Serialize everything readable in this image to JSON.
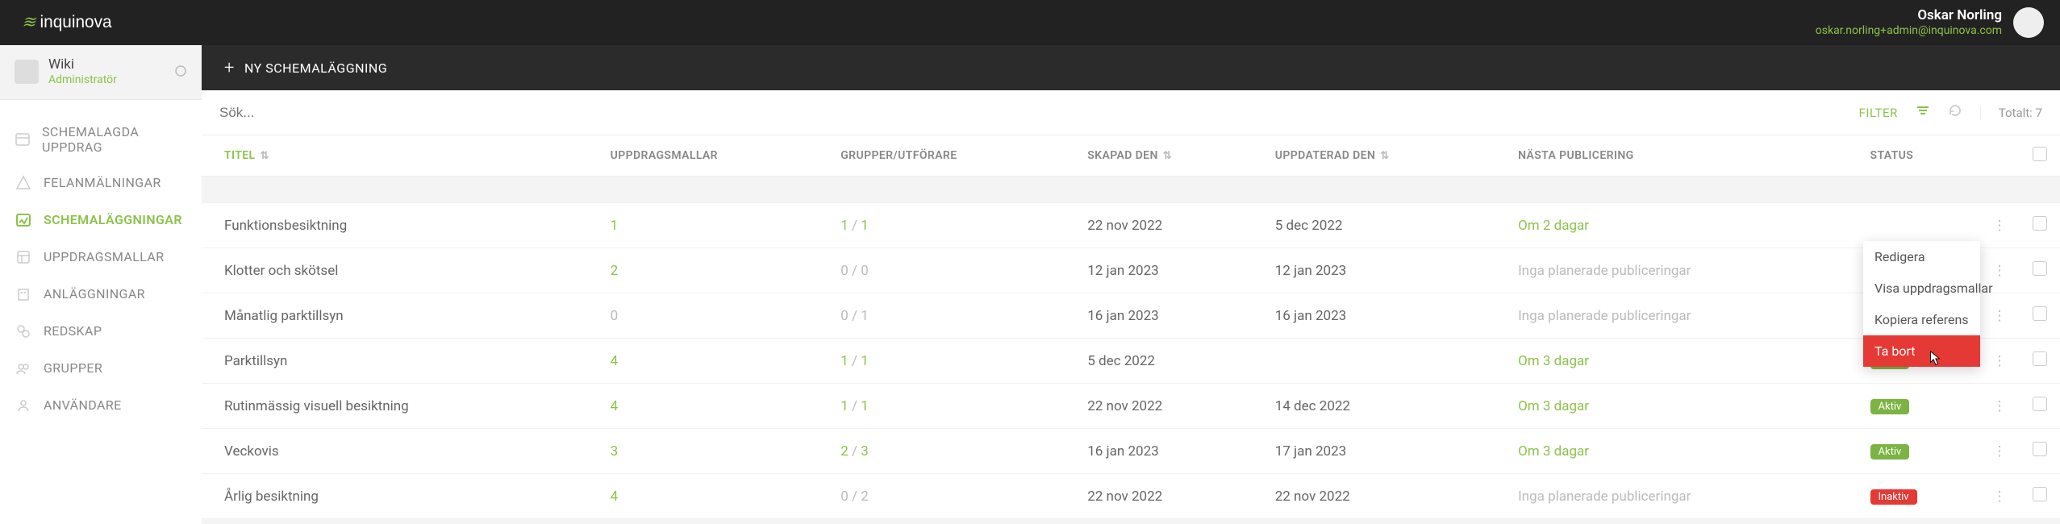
{
  "brand": "inquinova",
  "user": {
    "name": "Oskar Norling",
    "email": "oskar.norling+admin@inquinova.com"
  },
  "side": {
    "profile_name": "Wiki",
    "profile_role": "Administratör",
    "items": [
      {
        "label": "SCHEMALAGDA UPPDRAG"
      },
      {
        "label": "FELANMÄLNINGAR"
      },
      {
        "label": "SCHEMALÄGGNINGAR"
      },
      {
        "label": "UPPDRAGSMALLAR"
      },
      {
        "label": "ANLÄGGNINGAR"
      },
      {
        "label": "REDSKAP"
      },
      {
        "label": "GRUPPER"
      },
      {
        "label": "ANVÄNDARE"
      }
    ]
  },
  "toolbar": {
    "new_label": "NY SCHEMALÄGGNING"
  },
  "filter": {
    "placeholder": "Sök...",
    "filter_label": "FILTER",
    "total_label": "Totalt:",
    "total_value": "7"
  },
  "columns": {
    "title": "TITEL",
    "templates": "UPPDRAGSMALLAR",
    "groups": "GRUPPER/UTFÖRARE",
    "created": "SKAPAD DEN",
    "updated": "UPPDATERAD DEN",
    "next": "NÄSTA PUBLICERING",
    "status": "STATUS"
  },
  "rows": [
    {
      "title": "Funktionsbesiktning",
      "templates": "1",
      "g1": "1",
      "g2": "1",
      "g1zero": false,
      "created": "22 nov 2022",
      "updated": "5 dec 2022",
      "next": "Om 2 dagar",
      "next_plan": false,
      "status": "",
      "badge": ""
    },
    {
      "title": "Klotter och skötsel",
      "templates": "2",
      "g1": "0",
      "g2": "0",
      "g1zero": true,
      "created": "12 jan 2023",
      "updated": "12 jan 2023",
      "next": "Inga planerade publiceringar",
      "next_plan": true,
      "status": "",
      "badge": ""
    },
    {
      "title": "Månatlig parktillsyn",
      "templates": "0",
      "g1": "0",
      "g2": "1",
      "g1zero": true,
      "created": "16 jan 2023",
      "updated": "16 jan 2023",
      "next": "Inga planerade publiceringar",
      "next_plan": true,
      "status": "",
      "badge": ""
    },
    {
      "title": "Parktillsyn",
      "templates": "4",
      "g1": "1",
      "g2": "1",
      "g1zero": false,
      "created": "5 dec 2022",
      "updated": "",
      "next": "Om 3 dagar",
      "next_plan": false,
      "status": "Aktiv",
      "badge": "ok"
    },
    {
      "title": "Rutinmässig visuell besiktning",
      "templates": "4",
      "g1": "1",
      "g2": "1",
      "g1zero": false,
      "created": "22 nov 2022",
      "updated": "14 dec 2022",
      "next": "Om 3 dagar",
      "next_plan": false,
      "status": "Aktiv",
      "badge": "ok"
    },
    {
      "title": "Veckovis",
      "templates": "3",
      "g1": "2",
      "g2": "3",
      "g1zero": false,
      "created": "16 jan 2023",
      "updated": "17 jan 2023",
      "next": "Om 3 dagar",
      "next_plan": false,
      "status": "Aktiv",
      "badge": "ok"
    },
    {
      "title": "Årlig besiktning",
      "templates": "4",
      "g1": "0",
      "g2": "2",
      "g1zero": true,
      "created": "22 nov 2022",
      "updated": "22 nov 2022",
      "next": "Inga planerade publiceringar",
      "next_plan": true,
      "status": "Inaktiv",
      "badge": "inactive"
    }
  ],
  "ctx": {
    "edit": "Redigera",
    "show": "Visa uppdragsmallar",
    "copy": "Kopiera referens",
    "del": "Ta bort"
  }
}
